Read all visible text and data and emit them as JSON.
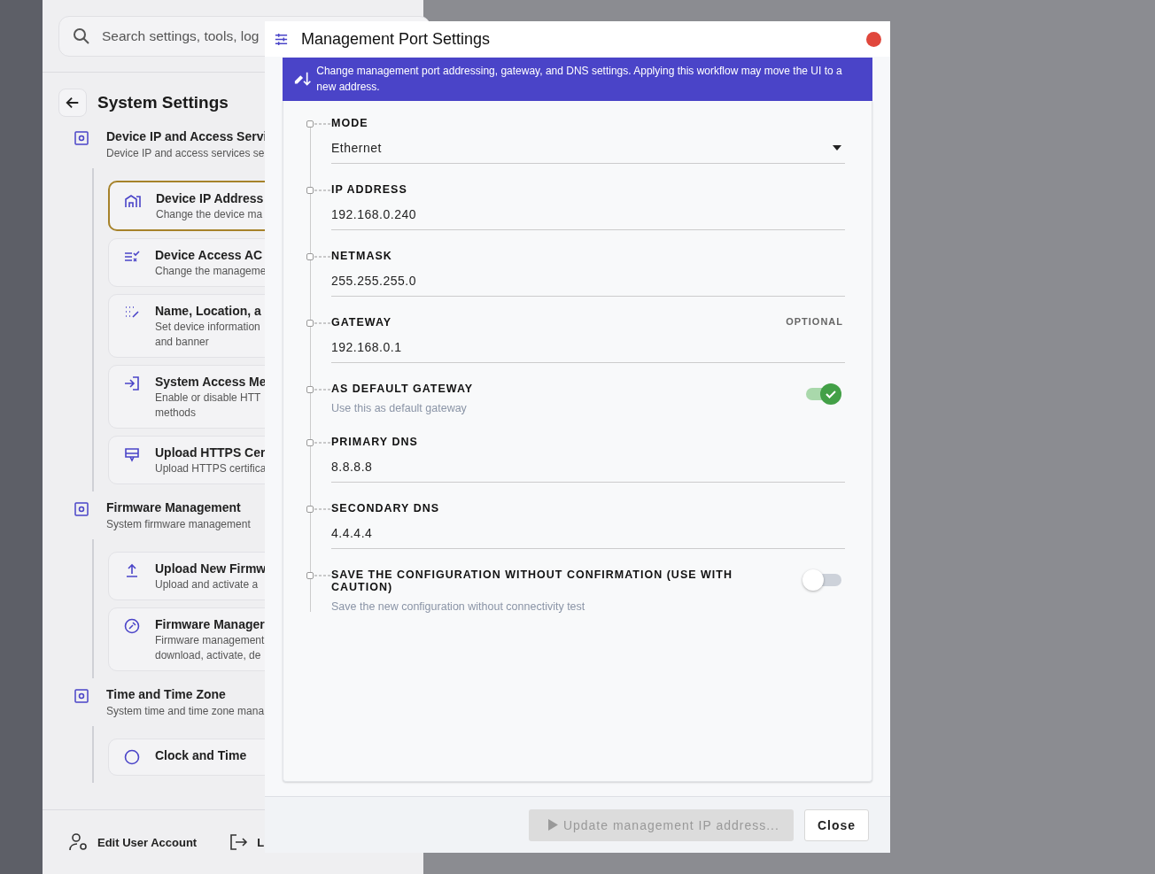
{
  "settings_panel": {
    "search": {
      "placeholder": "Search settings, tools, log"
    },
    "title": "System Settings",
    "sections": [
      {
        "title": "Device IP and Access Servi",
        "description": "Device IP and access services se",
        "items": [
          {
            "title": "Device IP Address",
            "lines": [
              "Change the device ma"
            ],
            "selected": true
          },
          {
            "title": "Device Access AC",
            "lines": [
              "Change the manageme"
            ],
            "selected": false
          },
          {
            "title": "Name, Location, a",
            "lines": [
              "Set device information",
              "and banner"
            ],
            "selected": false
          },
          {
            "title": "System Access Me",
            "lines": [
              "Enable or disable HTT",
              "methods"
            ],
            "selected": false
          },
          {
            "title": "Upload HTTPS Cer",
            "lines": [
              "Upload HTTPS certifica"
            ],
            "selected": false
          }
        ]
      },
      {
        "title": "Firmware Management",
        "description": "System firmware management",
        "items": [
          {
            "title": "Upload New Firmw",
            "lines": [
              "Upload and activate a"
            ],
            "selected": false
          },
          {
            "title": "Firmware Manager",
            "lines": [
              "Firmware management",
              "download, activate, de"
            ],
            "selected": false
          }
        ]
      },
      {
        "title": "Time and Time Zone",
        "description": "System time and time zone mana",
        "items": [
          {
            "title": "Clock and Time",
            "selected": false
          }
        ]
      }
    ],
    "footer": [
      {
        "label": "Edit User Account"
      },
      {
        "label": "L"
      }
    ]
  },
  "dialog": {
    "title": "Management Port Settings",
    "banner": "Change management port addressing, gateway, and DNS settings. Applying this workflow may move the UI to a new address.",
    "fields": [
      {
        "kind": "select",
        "label": "MODE",
        "value": "Ethernet"
      },
      {
        "kind": "text",
        "label": "IP ADDRESS",
        "value": "192.168.0.240"
      },
      {
        "kind": "text",
        "label": "NETMASK",
        "value": "255.255.255.0"
      },
      {
        "kind": "text",
        "label": "GATEWAY",
        "value": "192.168.0.1",
        "hint": "OPTIONAL"
      },
      {
        "kind": "toggle",
        "label": "AS DEFAULT GATEWAY",
        "description": "Use this as default gateway",
        "on": true
      },
      {
        "kind": "text",
        "label": "PRIMARY DNS",
        "value": "8.8.8.8"
      },
      {
        "kind": "text",
        "label": "SECONDARY DNS",
        "value": "4.4.4.4"
      },
      {
        "kind": "toggle",
        "label": "SAVE THE CONFIGURATION WITHOUT CONFIRMATION (USE WITH CAUTION)",
        "description": "Save the new configuration without connectivity test",
        "on": false
      }
    ],
    "buttons": [
      {
        "label": "Update management IP address...",
        "disabled": true,
        "kind": "run"
      },
      {
        "label": "Close",
        "disabled": false,
        "kind": "plain"
      }
    ]
  }
}
